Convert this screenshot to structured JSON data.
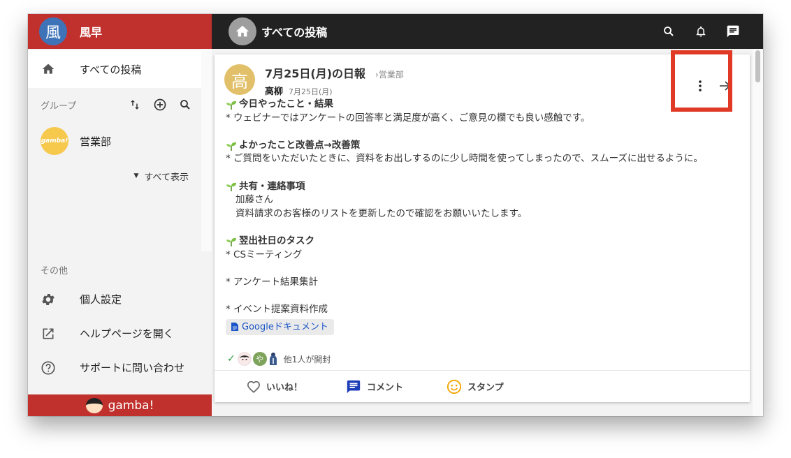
{
  "app": {
    "workspace_initial": "風",
    "workspace_name": "風早",
    "brand": "gamba!"
  },
  "sidebar": {
    "all_posts": "すべての投稿",
    "groups_label": "グループ",
    "groups": [
      {
        "name": "営業部",
        "logo_text": "gamba!"
      }
    ],
    "show_all": "すべて表示",
    "others_label": "その他",
    "others": [
      {
        "label": "個人設定",
        "icon": "gear-icon"
      },
      {
        "label": "ヘルプページを開く",
        "icon": "external-link-icon"
      },
      {
        "label": "サポートに問い合わせ",
        "icon": "help-circle-icon"
      }
    ]
  },
  "topbar": {
    "title": "すべての投稿"
  },
  "post": {
    "author_initial": "高",
    "title": "7月25日(月)の日報",
    "group": "›営業部",
    "author": "高柳",
    "date": "7月25日(月)",
    "sections": [
      {
        "heading": "今日やったこと・結果",
        "lines": [
          "* ウェビナーではアンケートの回答率と満足度が高く、ご意見の欄でも良い感触です。"
        ]
      },
      {
        "heading": "よかったこと改善点→改善策",
        "lines": [
          "* ご質問をいただいたときに、資料をお出しするのに少し時間を使ってしまったので、スムーズに出せるように。"
        ]
      },
      {
        "heading": "共有・連絡事項",
        "lines": [
          "加藤さん",
          "資料請求のお客様のリストを更新したので確認をお願いいたします。"
        ]
      },
      {
        "heading": "翌出社日のタスク",
        "lines": [
          "* CSミーティング",
          "",
          "* アンケート結果集計",
          "",
          "* イベント提案資料作成"
        ]
      }
    ],
    "attachment": "Googleドキュメント",
    "reader_initial": "や",
    "readers_text": "他1人が開封",
    "actions": {
      "like": "いいね！",
      "comment": "コメント",
      "stamp": "スタンプ"
    }
  }
}
